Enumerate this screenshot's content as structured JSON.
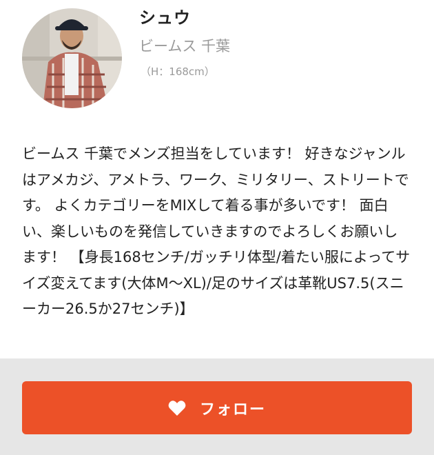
{
  "profile": {
    "name": "シュウ",
    "shop": "ビームス 千葉",
    "height": "（H：168cm）",
    "bio": "ビームス 千葉でメンズ担当をしています！ 好きなジャンルはアメカジ、アメトラ、ワーク、ミリタリー、ストリートです。 よくカテゴリーをMIXして着る事が多いです！ 面白い、楽しいものを発信していきますのでよろしくお願いします！ 【身長168センチ/ガッチリ体型/着たい服によってサイズ変えてます(大体M〜XL)/足のサイズは革靴US7.5(スニーカー26.5か27センチ)】"
  },
  "follow": {
    "label": "フォロー",
    "icon": "heart-icon"
  },
  "colors": {
    "accent": "#ec5128",
    "footer_bg": "#e6e6e6",
    "muted_text": "#9a9a9a"
  }
}
